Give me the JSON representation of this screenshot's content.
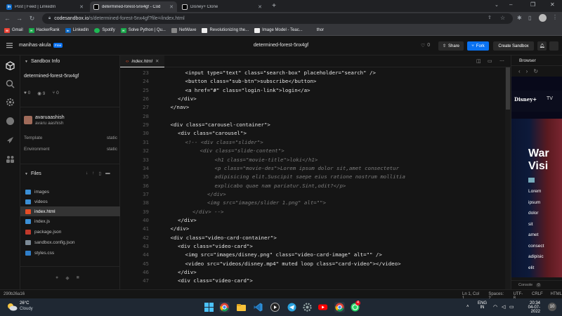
{
  "browser": {
    "tabs": [
      {
        "label": "Post | Feed | LinkedIn",
        "favicon": "linkedin-icon",
        "active": false
      },
      {
        "label": "determined-forest-5nx4gf - Cod",
        "favicon": "codesandbox-icon",
        "active": true
      },
      {
        "label": "Disney+ Clone",
        "favicon": "codesandbox-icon",
        "active": false
      }
    ],
    "url_host": "codesandbox.io",
    "url_path": "/s/determined-forest-5nx4gf?file=/index.html",
    "bookmarks": [
      "Gmail",
      "HackerRank",
      "LinkedIn",
      "Spotify",
      "Solve Python | Qu...",
      "NetWave",
      "Revolutionizing the...",
      "Image Model - Teac...",
      "thor"
    ]
  },
  "header": {
    "user": "manihas-akula",
    "plan": "Free",
    "sandbox_title": "determined-forest-5nx4gf",
    "likes": "0",
    "share_label": "Share",
    "fork_label": "Fork",
    "create_label": "Create Sandbox"
  },
  "sidebar": {
    "title": "Sandbox Info",
    "sandbox_name": "determined-forest-5nx4gf",
    "stats": {
      "likes": "0",
      "views": "9",
      "forks": "0"
    },
    "author_name": "avaruaashish",
    "author_handle": "avaru aashish",
    "template_label": "Template",
    "template_value": "static",
    "environment_label": "Environment",
    "environment_value": "static",
    "files_title": "Files",
    "files": [
      {
        "name": "images",
        "type": "folder"
      },
      {
        "name": "videos",
        "type": "folder"
      },
      {
        "name": "index.html",
        "type": "html",
        "selected": true
      },
      {
        "name": "index.js",
        "type": "js"
      },
      {
        "name": "package.json",
        "type": "json"
      },
      {
        "name": "sandbox.config.json",
        "type": "config"
      },
      {
        "name": "styles.css",
        "type": "css"
      }
    ]
  },
  "editor": {
    "tab_label": "index.html",
    "lines": [
      {
        "n": "23",
        "indent": 3,
        "text": "<input type=\"text\" class=\"search-box\" placeholder=\"search\" />"
      },
      {
        "n": "24",
        "indent": 3,
        "text": "<button class=\"sub-btn\">subscribe</button>"
      },
      {
        "n": "25",
        "indent": 3,
        "text": "<a href=\"#\" class=\"login-link\">login</a>"
      },
      {
        "n": "26",
        "indent": 2,
        "text": "</div>"
      },
      {
        "n": "27",
        "indent": 1,
        "text": "</nav>"
      },
      {
        "n": "28",
        "indent": 0,
        "text": ""
      },
      {
        "n": "29",
        "indent": 1,
        "text": "<div class=\"carousel-container\">"
      },
      {
        "n": "30",
        "indent": 2,
        "text": "<div class=\"carousel\">"
      },
      {
        "n": "31",
        "indent": 3,
        "text": "<!-- <div class=\"slider\">",
        "comment": true
      },
      {
        "n": "32",
        "indent": 5,
        "text": "<div class=\"slide-content\">",
        "comment": true
      },
      {
        "n": "33",
        "indent": 7,
        "text": "<h1 class=\"movie-title\">loki</h1>",
        "comment": true
      },
      {
        "n": "34",
        "indent": 7,
        "text": "<p class=\"movie-des\">Lorem ipsum dolor sit,amet consectetur",
        "comment": true
      },
      {
        "n": "35",
        "indent": 7,
        "text": "adipisicing elit.Suscipit saepe eius ratione nostrum mollitia",
        "comment": true
      },
      {
        "n": "36",
        "indent": 7,
        "text": "explicabo quae nam pariatur.Sint,odit?</p>",
        "comment": true
      },
      {
        "n": "37",
        "indent": 6,
        "text": "</div>",
        "comment": true
      },
      {
        "n": "38",
        "indent": 6,
        "text": "<img src=\"images/slider 1.png\" alt=\"\">",
        "comment": true
      },
      {
        "n": "39",
        "indent": 4,
        "text": "</div> -->",
        "comment": true
      },
      {
        "n": "40",
        "indent": 2,
        "text": "</div>"
      },
      {
        "n": "41",
        "indent": 1,
        "text": "</div>"
      },
      {
        "n": "42",
        "indent": 1,
        "text": "<div class=\"video-card-container\">"
      },
      {
        "n": "43",
        "indent": 2,
        "text": "<div class=\"video-card\">"
      },
      {
        "n": "44",
        "indent": 3,
        "text": "<img src=\"images/disney.png\" class=\"video-card-image\" alt=\"\" />"
      },
      {
        "n": "45",
        "indent": 3,
        "text": "<video src=\"videos/disney.mp4\" muted loop class=\"card-video\"></video>"
      },
      {
        "n": "46",
        "indent": 2,
        "text": "</div>"
      },
      {
        "n": "47",
        "indent": 2,
        "text": "<div class=\"video-card\">"
      }
    ]
  },
  "preview": {
    "title": "Browser",
    "nav_tv": "TV",
    "logo": "Disney+",
    "hero_title_1": "War",
    "hero_title_2": "Visi",
    "hero_words": [
      "Lorem",
      "ipsum",
      "dolor",
      "sit",
      "amet",
      "consect",
      "adipisic",
      "elit"
    ],
    "console_label": "Console",
    "console_count": "0"
  },
  "status": {
    "hash": "290b26a16",
    "position": "Ln 1, Col 1",
    "spaces": "Spaces: 2",
    "encoding": "UTF-8",
    "eol": "CRLF",
    "language": "HTML"
  },
  "taskbar": {
    "temp": "26°C",
    "weather": "Cloudy",
    "lang_top": "ENG",
    "lang_bottom": "IN",
    "time": "20:34",
    "date": "04-07-2022",
    "whatsapp_badge": "4"
  },
  "colors": {
    "accent": "#0971f1",
    "bg": "#151515",
    "selected_file": "#333333"
  }
}
